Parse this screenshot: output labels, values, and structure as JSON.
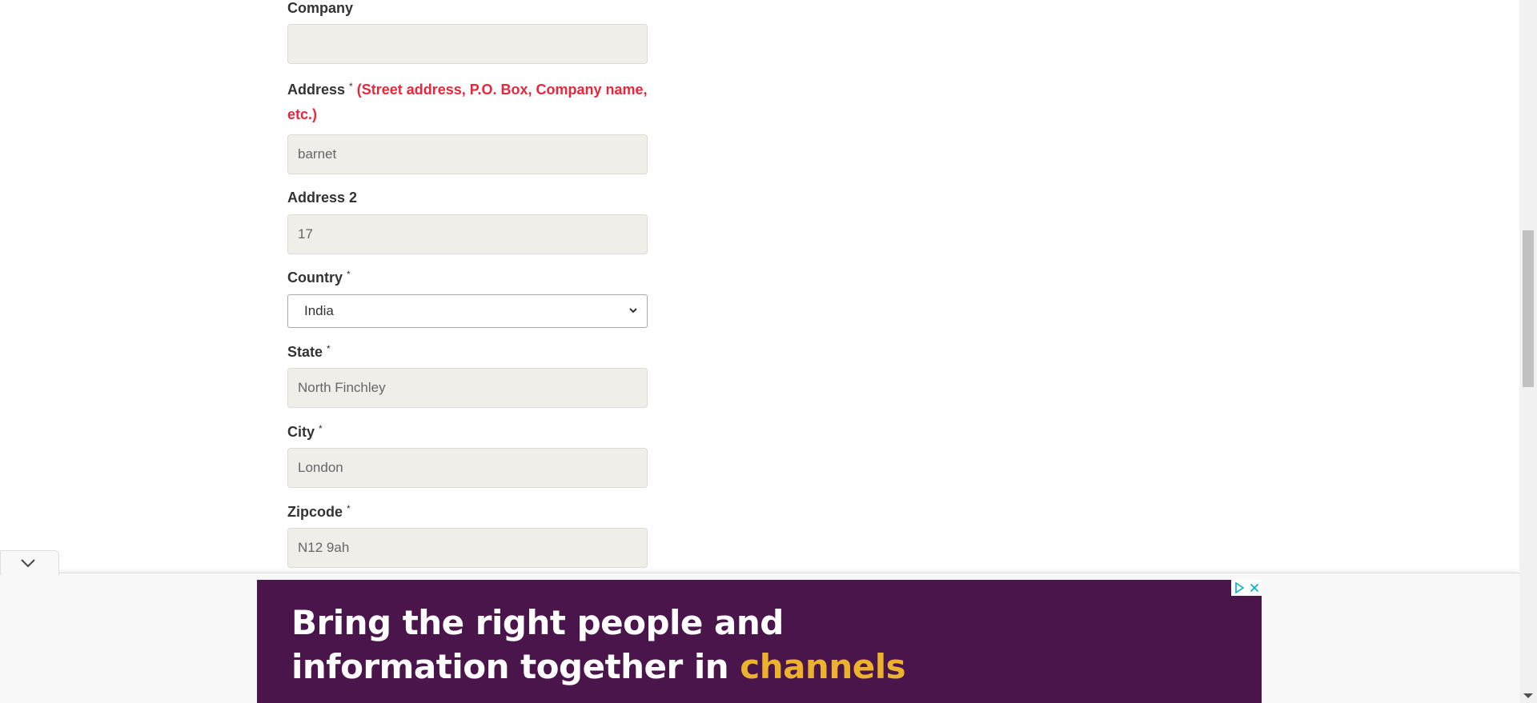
{
  "form": {
    "company": {
      "label": "Company",
      "value": ""
    },
    "address": {
      "label": "Address",
      "required_mark": "*",
      "hint_line1": "(Street address, P.O. Box, Company name,",
      "hint_line2": "etc.)",
      "value": "barnet"
    },
    "address2": {
      "label": "Address 2",
      "value": "17"
    },
    "country": {
      "label": "Country",
      "required_mark": "*",
      "selected": "India"
    },
    "state": {
      "label": "State",
      "required_mark": "*",
      "value": "North Finchley"
    },
    "city": {
      "label": "City",
      "required_mark": "*",
      "value": "London"
    },
    "zipcode": {
      "label": "Zipcode",
      "required_mark": "*",
      "value": "N12 9ah"
    }
  },
  "ad": {
    "headline_part1": "Bring the right people and",
    "headline_part2": "information together in ",
    "headline_highlight": "channels",
    "background_color": "#4a154b",
    "highlight_color": "#ecb22e",
    "icons": [
      "adchoices-icon",
      "close-icon"
    ]
  },
  "colors": {
    "required_hint": "#e8273c",
    "input_background": "#efeee9"
  }
}
